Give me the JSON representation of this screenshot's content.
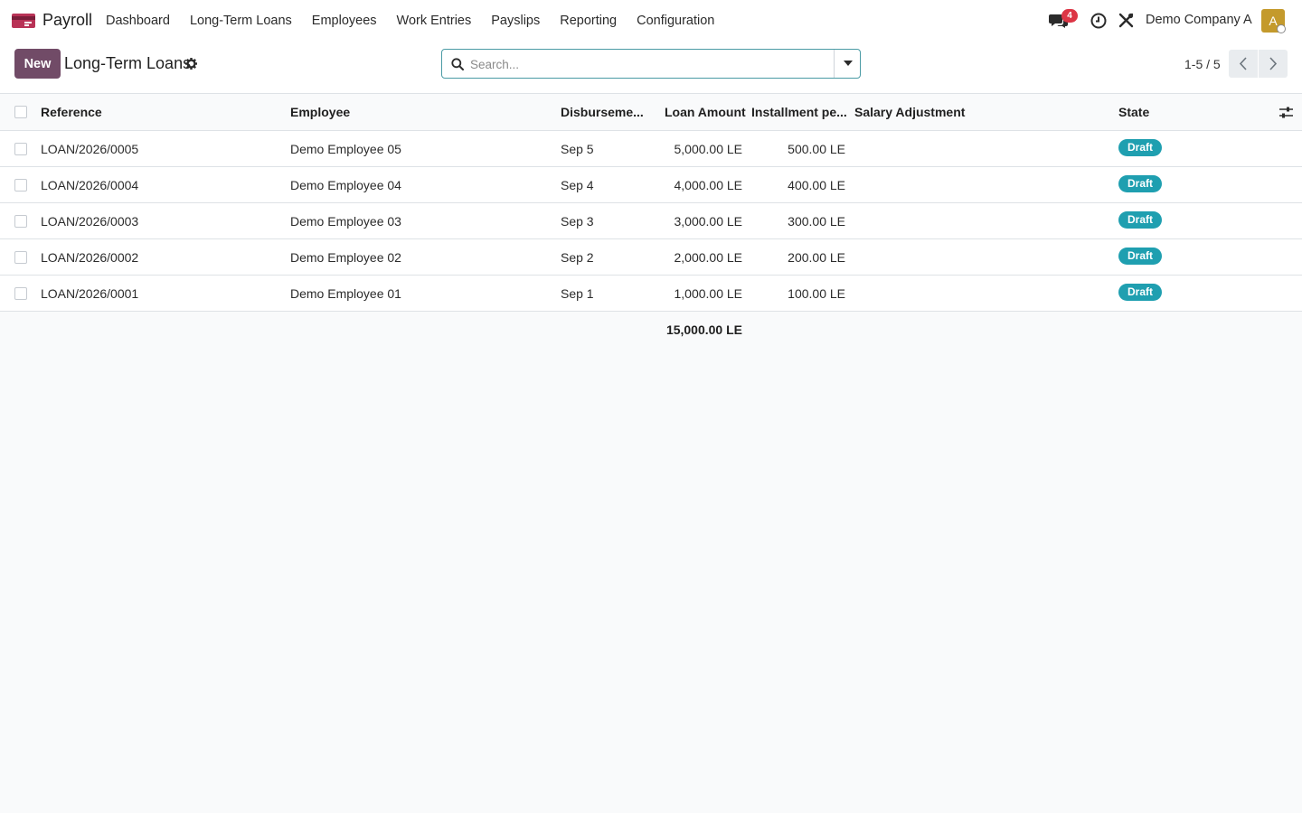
{
  "app": {
    "name": "Payroll",
    "icon": "payroll-app-icon",
    "accent_color": "#714b67"
  },
  "menu": [
    {
      "label": "Dashboard"
    },
    {
      "label": "Long-Term Loans"
    },
    {
      "label": "Employees"
    },
    {
      "label": "Work Entries"
    },
    {
      "label": "Payslips"
    },
    {
      "label": "Reporting"
    },
    {
      "label": "Configuration"
    }
  ],
  "systray": {
    "messages_count": "4",
    "company": "Demo Company A",
    "avatar_initial": "A"
  },
  "control_panel": {
    "new_label": "New",
    "title": "Long-Term Loans",
    "search_placeholder": "Search...",
    "pager": "1-5 / 5"
  },
  "table": {
    "columns": {
      "reference": "Reference",
      "employee": "Employee",
      "disbursement": "Disburseme...",
      "loan_amount": "Loan Amount",
      "installment": "Installment pe...",
      "salary_adjustment": "Salary Adjustment",
      "state": "State"
    },
    "rows": [
      {
        "reference": "LOAN/2026/0005",
        "employee": "Demo Employee 05",
        "disbursement": "Sep 5",
        "loan_amount": "5,000.00 LE",
        "installment": "500.00 LE",
        "salary_adjustment": "",
        "state": "Draft"
      },
      {
        "reference": "LOAN/2026/0004",
        "employee": "Demo Employee 04",
        "disbursement": "Sep 4",
        "loan_amount": "4,000.00 LE",
        "installment": "400.00 LE",
        "salary_adjustment": "",
        "state": "Draft"
      },
      {
        "reference": "LOAN/2026/0003",
        "employee": "Demo Employee 03",
        "disbursement": "Sep 3",
        "loan_amount": "3,000.00 LE",
        "installment": "300.00 LE",
        "salary_adjustment": "",
        "state": "Draft"
      },
      {
        "reference": "LOAN/2026/0002",
        "employee": "Demo Employee 02",
        "disbursement": "Sep 2",
        "loan_amount": "2,000.00 LE",
        "installment": "200.00 LE",
        "salary_adjustment": "",
        "state": "Draft"
      },
      {
        "reference": "LOAN/2026/0001",
        "employee": "Demo Employee 01",
        "disbursement": "Sep 1",
        "loan_amount": "1,000.00 LE",
        "installment": "100.00 LE",
        "salary_adjustment": "",
        "state": "Draft"
      }
    ],
    "total_loan_amount": "15,000.00 LE",
    "state_badge_color": "#1f9fb0"
  }
}
